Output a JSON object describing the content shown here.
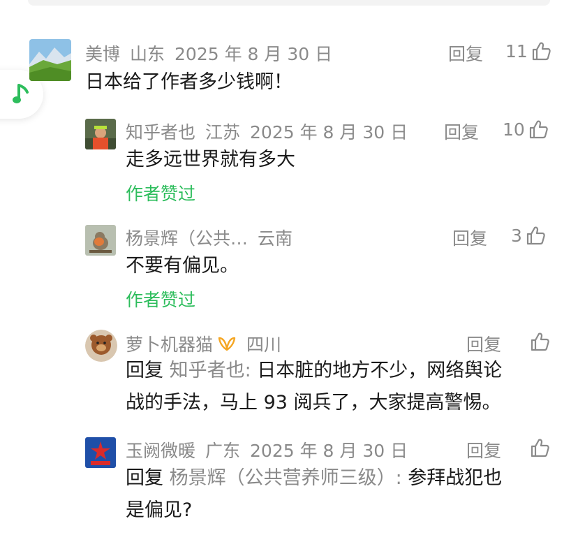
{
  "colors": {
    "muted": "#8a8a8a",
    "text": "#1a1a1a",
    "green": "#2dbd5c",
    "gold": "#f5a623"
  },
  "icons": {
    "music": "music-note-icon",
    "like": "thumb-up-icon",
    "badge": "gold-badge-icon"
  },
  "comments": [
    {
      "user": "美博",
      "location": "山东",
      "date": "2025 年 8 月 30 日",
      "reply_label": "回复",
      "likes": "11",
      "text": "日本给了作者多少钱啊！"
    },
    {
      "user": "知乎者也",
      "location": "江苏",
      "date": "2025 年 8 月 30 日",
      "reply_label": "回复",
      "likes": "10",
      "text": "走多远世界就有多大",
      "author_liked": "作者赞过"
    },
    {
      "user": "杨景辉（公共…",
      "location": "云南",
      "reply_label": "回复",
      "likes": "3",
      "text": "不要有偏见。",
      "author_liked": "作者赞过"
    },
    {
      "user": "萝卜机器猫",
      "location": "四川",
      "reply_label": "回复",
      "reply_prefix": "回复",
      "reply_target": "知乎者也:",
      "text_line1": "日本脏的地方不少，网络舆论",
      "text_line2": "战的手法，马上 93 阅兵了，大家提高警惕。"
    },
    {
      "user": "玉阙微暖",
      "location": "广东",
      "date": "2025 年 8 月 30 日",
      "reply_label": "回复",
      "reply_prefix": "回复",
      "reply_target": "杨景辉（公共营养师三级）:",
      "text_line1": "参拜战犯也",
      "text_line2": "是偏见?"
    }
  ]
}
